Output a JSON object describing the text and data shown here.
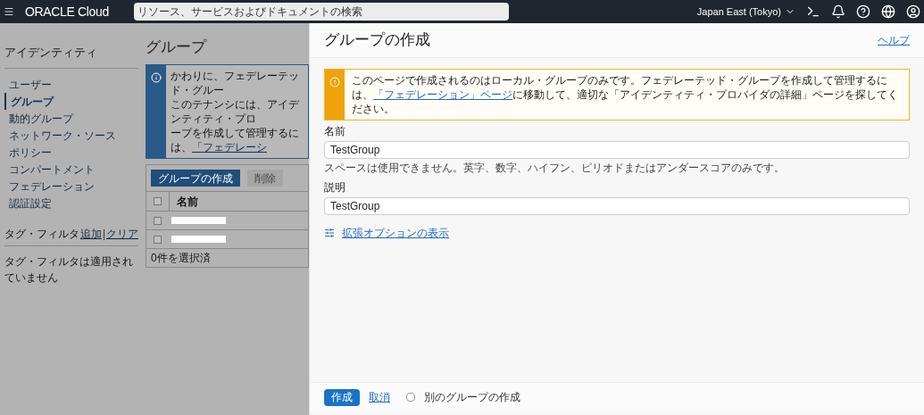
{
  "header": {
    "brand": "ORACLE Cloud",
    "search": {
      "placeholder": "リソース、サービスおよびドキュメントの検索"
    },
    "region": "Japan East (Tokyo)"
  },
  "sidebar": {
    "title": "アイデンティティ",
    "items": [
      {
        "label": "ユーザー",
        "selected": false
      },
      {
        "label": "グループ",
        "selected": true
      },
      {
        "label": "動的グループ",
        "selected": false
      },
      {
        "label": "ネットワーク・ソース",
        "selected": false
      },
      {
        "label": "ポリシー",
        "selected": false
      },
      {
        "label": "コンパートメント",
        "selected": false
      },
      {
        "label": "フェデレーション",
        "selected": false
      },
      {
        "label": "認証設定",
        "selected": false
      }
    ],
    "tag_filter": {
      "title": "タグ・フィルタ",
      "add": "追加",
      "separator": "|",
      "clear": "クリア",
      "empty": "タグ・フィルタは適用されていません"
    }
  },
  "page": {
    "title": "グループ",
    "info": {
      "title": "かわりに、フェデレーテッド・グルー",
      "line_1": "このテナンシには、アイデンティティ・プロ",
      "line_2": "ープを作成して管理するには、",
      "link": "「フェデレーシ"
    },
    "buttons": [
      {
        "label": "グループの作成",
        "disabled": false
      },
      {
        "label": "削除",
        "disabled": true
      }
    ],
    "table": {
      "select_all": {
        "checked": false
      },
      "columns": [
        "名前"
      ],
      "rows": [
        {
          "checked": false
        },
        {
          "checked": false
        }
      ],
      "footer": "0件を選択済"
    }
  },
  "panel": {
    "title": "グループの作成",
    "help": "ヘルプ",
    "alert": {
      "text_before": "このページで作成されるのはローカル・グループのみです。フェデレーテッド・グループを作成して管理するには、",
      "link": "「フェデレーション」ページ",
      "text_after": "に移動して、適切な「アイデンティティ・プロバイダの詳細」ページを探してください。"
    },
    "fields": [
      {
        "label": "名前",
        "value": "TestGroup",
        "hint": "スペースは使用できません。英字、数字、ハイフン、ピリオドまたはアンダースコアのみです。"
      },
      {
        "label": "説明",
        "value": "TestGroup"
      }
    ],
    "advanced_link": "拡張オプションの表示",
    "footer": {
      "create": "作成",
      "cancel": "取消",
      "another": {
        "label": "別のグループの作成",
        "checked": false
      }
    }
  }
}
